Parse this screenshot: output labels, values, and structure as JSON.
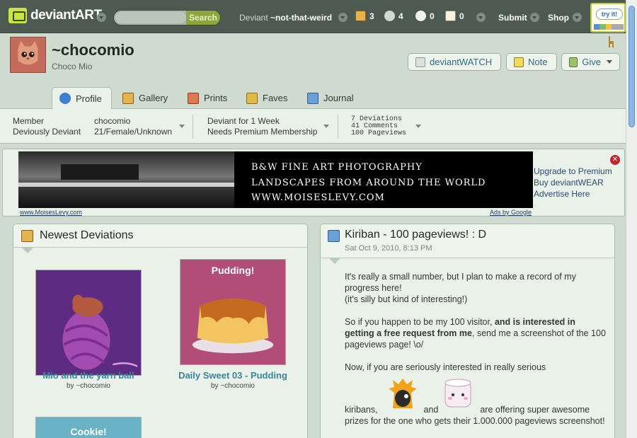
{
  "topbar": {
    "logo_main": "deviant",
    "logo_bold": "ART",
    "search_placeholder": "",
    "search_button": "Search",
    "deviant_prefix": "Deviant",
    "deviant_name": "~not-that-weird",
    "counts": {
      "messages": "3",
      "watch": "4",
      "comments": "0",
      "notes": "0"
    },
    "submit": "Submit",
    "shop": "Shop",
    "tryit": "try it!"
  },
  "profile": {
    "username": "~chocomio",
    "realname": "Choco Mio",
    "watch_button": "deviantWATCH",
    "note_button": "Note",
    "give_button": "Give"
  },
  "tabs": [
    {
      "label": "Profile",
      "active": true
    },
    {
      "label": "Gallery"
    },
    {
      "label": "Prints"
    },
    {
      "label": "Faves"
    },
    {
      "label": "Journal"
    }
  ],
  "info": {
    "member_line1": "Member",
    "member_line2": "Deviously Deviant",
    "user_line1": "chocomio",
    "user_line2": "21/Female/Unknown",
    "deviant_line1": "Deviant for 1 Week",
    "deviant_line2": "Needs Premium Membership",
    "stats": [
      "7 Deviations",
      "41 Comments",
      "100 Pageviews"
    ]
  },
  "ad": {
    "line1": "B&W  FINE ART   PHOTOGRAPHY",
    "line2": "LANDSCAPES FROM AROUND THE WORLD",
    "line3": "WWW.MOISESLEVY.COM",
    "url": "www.MoisesLevy.com",
    "google": "Ads by Google",
    "side_links": [
      "Upgrade to Premium",
      "Buy deviantWEAR",
      "Advertise Here"
    ]
  },
  "newest": {
    "title": "Newest Deviations",
    "items": [
      {
        "title": "Mio and the yarn ball",
        "by": "by ~chocomio",
        "thumb_text": ""
      },
      {
        "title": "Daily Sweet 03 - Pudding",
        "by": "by ~chocomio",
        "thumb_text": "Pudding!"
      },
      {
        "title": "",
        "by": "",
        "thumb_text": "Cookie!"
      }
    ]
  },
  "journal": {
    "title": "Kiriban - 100 pageviews! : D",
    "date": "Sat Oct 9, 2010, 8:13 PM",
    "p1_a": "It's really a small number, but I plan to make a record of my progress here!",
    "p1_b": "(it's silly but kind of interesting!)",
    "p2_a": "So if you happen to be my 100 visitor,",
    "p2_bold": "and is interested in getting a free request from me",
    "p2_b": ", send me a screenshot of the 100 pageviews page! \\o/",
    "p3": "Now, if you are seriously interested in really serious",
    "p4_a": "kiribans,",
    "p4_and": "and",
    "p4_b": "are offering super awesome prizes for the one who gets their 1.000.000 pageviews screenshot!"
  },
  "colors": {
    "topbar": "#4d5a52",
    "accent_green": "#8ba63c",
    "link_teal": "#3a8598",
    "panel_bg": "#eaf1e8"
  }
}
